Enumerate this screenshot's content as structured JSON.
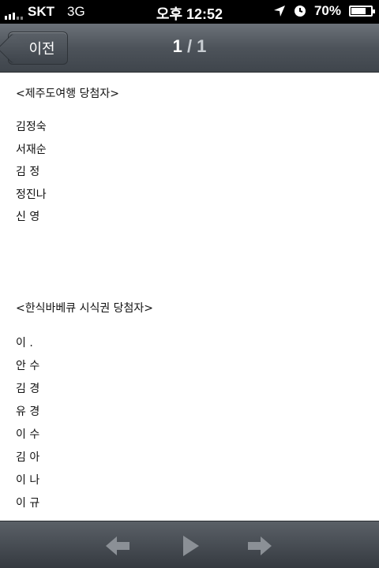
{
  "status_bar": {
    "carrier": "SKT",
    "network": "3G",
    "time": "오후 12:52",
    "battery_text": "70%",
    "battery_level": 0.7,
    "icons": [
      "signal-bars-icon",
      "location-arrow-icon",
      "alarm-clock-icon",
      "battery-icon"
    ]
  },
  "nav": {
    "back_label": "이전",
    "page_current": "1",
    "page_sep": " / ",
    "page_total": "1"
  },
  "content": {
    "section1_title": "<제주도여행 당첨자>",
    "section1_names": [
      "김정숙",
      "서재순",
      "김 정",
      "정진나",
      "신 영"
    ],
    "section2_title": "<한식바베큐 시식권 당첨자>",
    "section2_names": [
      "이 .",
      "안 수",
      "김 경",
      "유 경",
      "이 수",
      "김 아",
      "이 나",
      "이 규"
    ]
  },
  "toolbar": {
    "prev_icon": "arrow-left-icon",
    "play_icon": "play-icon",
    "next_icon": "arrow-right-icon"
  }
}
